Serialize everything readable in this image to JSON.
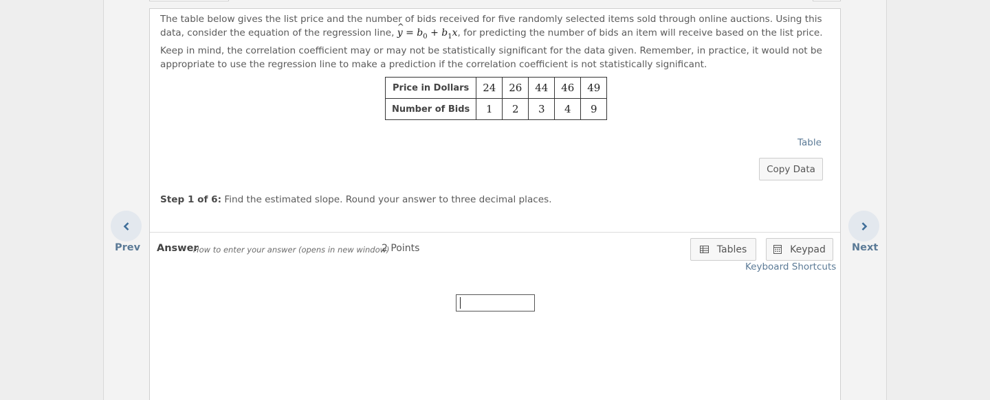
{
  "question": {
    "text_part1": "The table below gives the list price and the number of bids received for five randomly selected items sold through online auctions. Using this data, consider the equation of the regression line, ",
    "equation": {
      "yhat": "y",
      "eq": " = ",
      "b0": "b",
      "b0_sub": "0",
      "plus": " + ",
      "b1": "b",
      "b1_sub": "1",
      "x": "x"
    },
    "text_part2": ", for predicting the number of bids an item will receive based on the list price. Keep in mind, the correlation coefficient may or may not be statistically significant for the data given. Remember, in practice, it would not be appropriate to use the regression line to make a prediction if the correlation coefficient is not statistically significant."
  },
  "data_table": {
    "rows": [
      {
        "header": "Price in Dollars",
        "values": [
          "24",
          "26",
          "44",
          "46",
          "49"
        ]
      },
      {
        "header": "Number of Bids",
        "values": [
          "1",
          "2",
          "3",
          "4",
          "9"
        ]
      }
    ]
  },
  "table_link": "Table",
  "copy_data_label": "Copy Data",
  "step": {
    "label": "Step 1 of 6:",
    "text": " Find the estimated slope. Round your answer to three decimal places."
  },
  "answer": {
    "label": "Answer",
    "howto_link": "How to enter your answer (opens in new window)",
    "points": "2 Points",
    "tables_button": "Tables",
    "keypad_button": "Keypad",
    "keyboard_shortcuts": "Keyboard Shortcuts",
    "input_value": ""
  },
  "nav": {
    "prev": "Prev",
    "next": "Next"
  },
  "colors": {
    "link": "#5b7a96",
    "nav_circle": "#e3e8ee"
  }
}
